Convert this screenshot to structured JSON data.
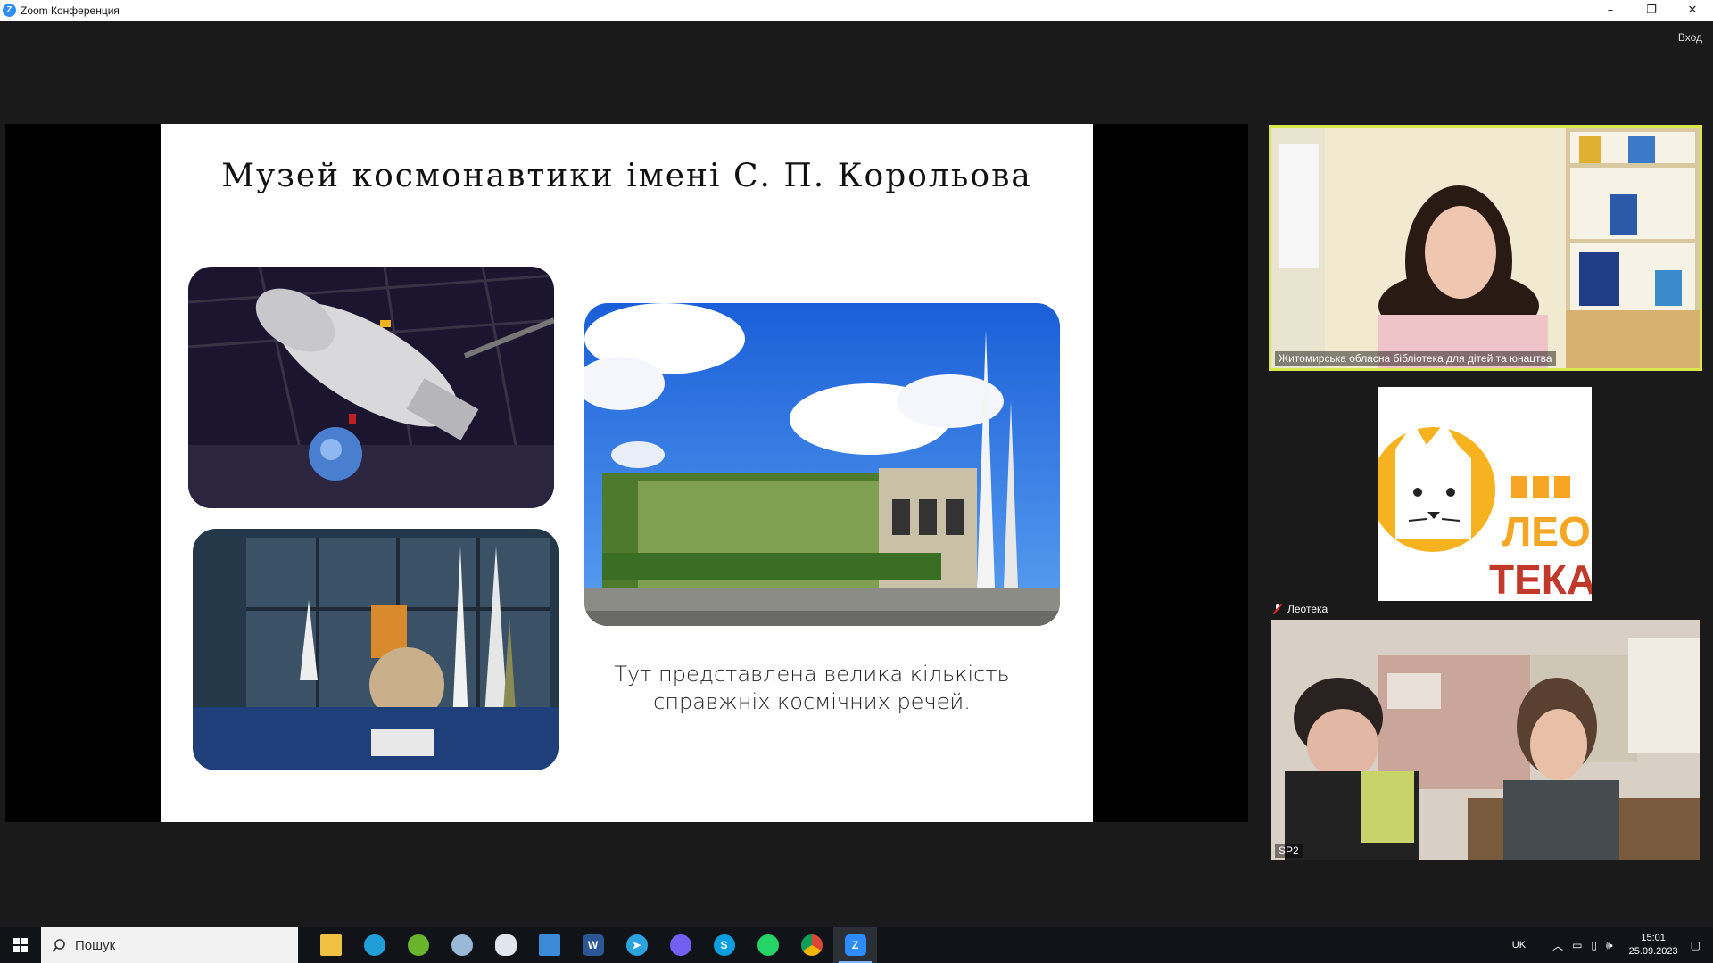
{
  "window": {
    "app_icon_letter": "Z",
    "title": "Zoom Конференция",
    "minimize": "–",
    "restore": "❐",
    "close": "✕"
  },
  "header": {
    "sign_in": "Вход"
  },
  "slide": {
    "title": "Музей космонавтики імені С. П. Корольова",
    "caption_line1": "Тут представлена велика кількість",
    "caption_line2": "справжніх космічних речей."
  },
  "participants": [
    {
      "name": "Житомирська обласна бібліотека для дітей та юнацтва",
      "active_speaker": true
    },
    {
      "name": "Леотека",
      "muted": true,
      "logo_text_1": "ЛЕО",
      "logo_text_2": "ТЕКА"
    },
    {
      "name": "SP2"
    }
  ],
  "taskbar": {
    "search_placeholder": "Пошук",
    "apps": [
      "folder-icon",
      "edge-icon",
      "utorrent-icon",
      "paint-icon",
      "cloud-app-icon",
      "remote-desktop-icon",
      "word-icon",
      "telegram-icon",
      "viber-icon",
      "skype-icon",
      "whatsapp-icon",
      "chrome-icon",
      "zoom-icon"
    ],
    "language": "UK",
    "time": "15:01",
    "date": "25.09.2023"
  },
  "colors": {
    "active_speaker_border": "#d7e84b",
    "zoom_blue": "#2d8cff",
    "leo_orange": "#f5a623",
    "leo_red": "#c0392b"
  }
}
